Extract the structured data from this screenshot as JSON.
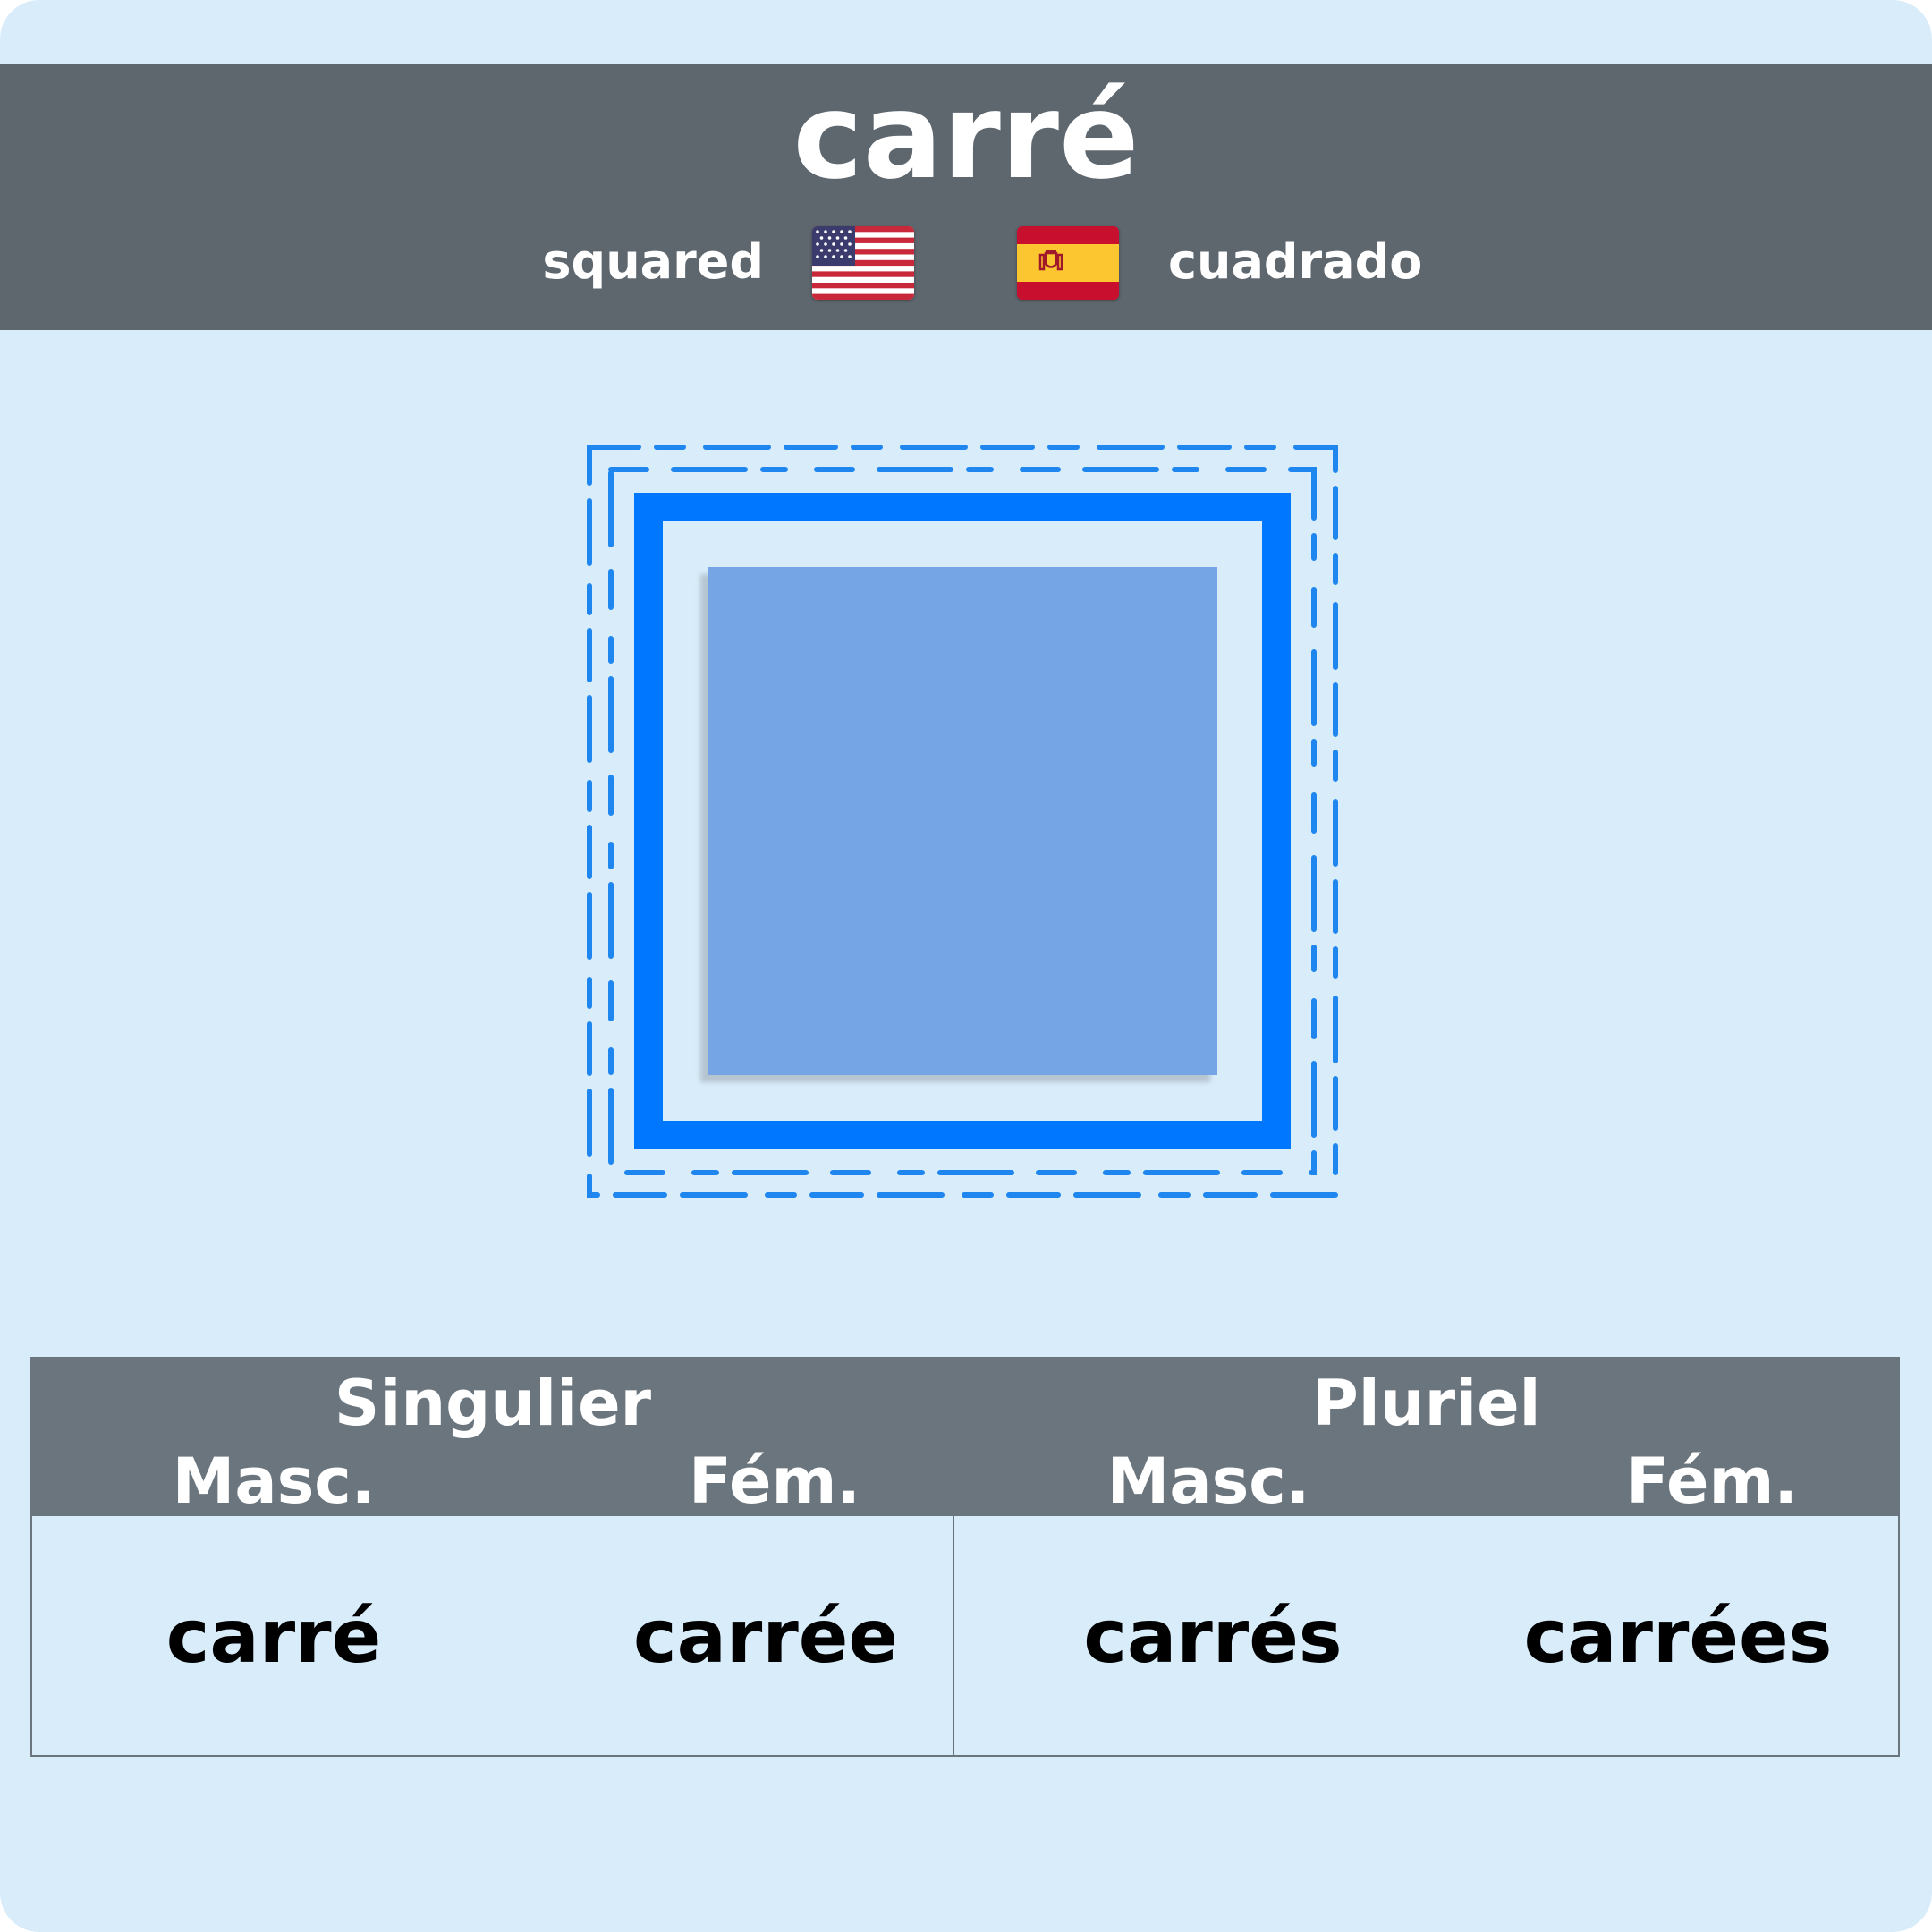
{
  "word": "carré",
  "translations": {
    "english": "squared",
    "spanish": "cuadrado"
  },
  "flags": {
    "english": "us-flag-icon",
    "spanish": "spain-flag-icon"
  },
  "illustration": "square-illustration",
  "colors": {
    "background": "#d8ecfa",
    "header": "#5e666e",
    "table_header": "#6b757e",
    "accent_blue": "#0077ff",
    "fill_blue": "#76a5e6"
  },
  "table": {
    "groups": [
      "Singulier",
      "Pluriel"
    ],
    "subheaders": [
      "Masc.",
      "Fém.",
      "Masc.",
      "Fém."
    ],
    "cells": [
      "carré",
      "carrée",
      "carrés",
      "carrées"
    ]
  }
}
